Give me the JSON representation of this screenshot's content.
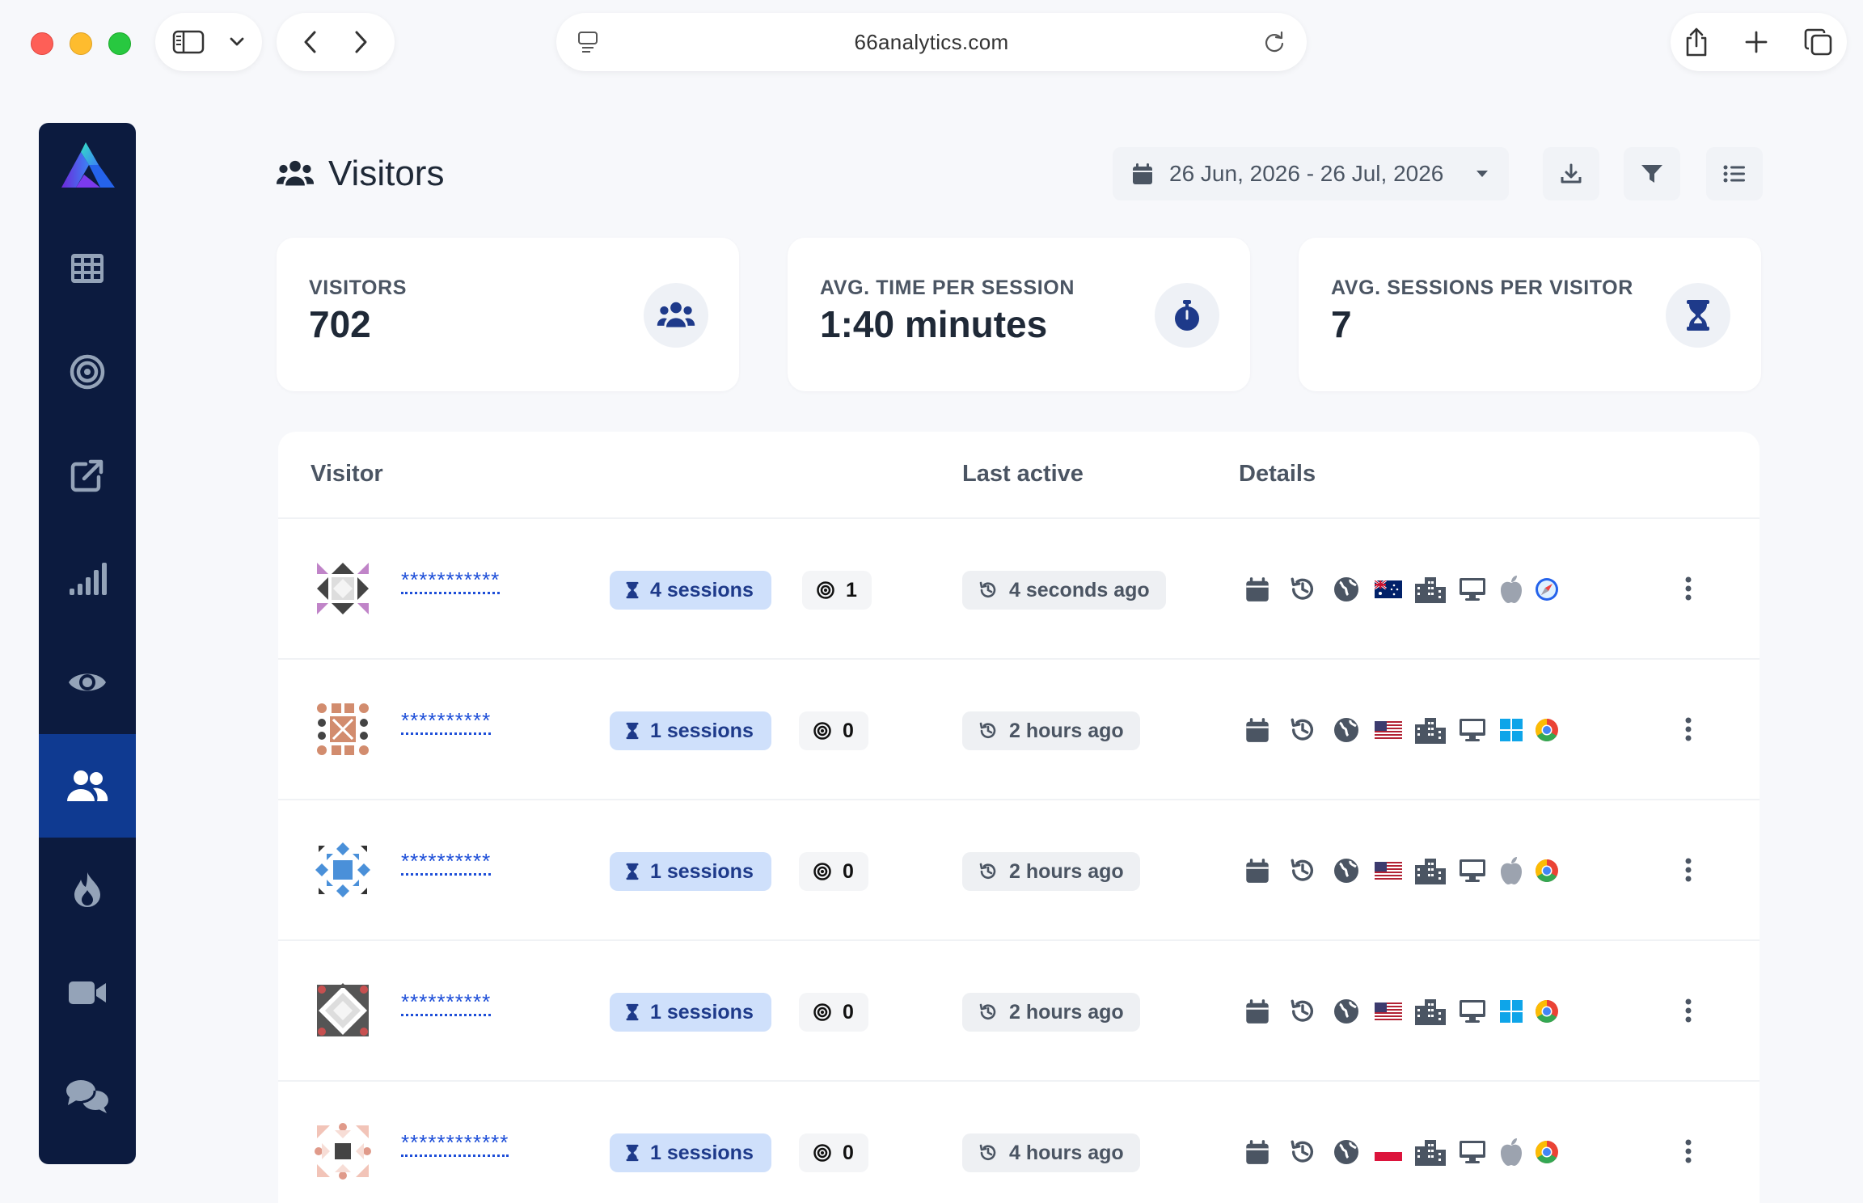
{
  "browser": {
    "url": "66analytics.com"
  },
  "sidebar": {
    "items": [
      {
        "icon": "grid-icon"
      },
      {
        "icon": "target-icon"
      },
      {
        "icon": "external-link-icon"
      },
      {
        "icon": "signal-bars-icon"
      },
      {
        "icon": "eye-icon"
      },
      {
        "icon": "users-icon",
        "active": true
      },
      {
        "icon": "fire-icon"
      },
      {
        "icon": "video-icon"
      },
      {
        "icon": "comments-icon"
      }
    ]
  },
  "header": {
    "title": "Visitors",
    "date_range": "26 Jun, 2026 - 26 Jul, 2026"
  },
  "stats": [
    {
      "label": "VISITORS",
      "value": "702",
      "icon": "users-icon"
    },
    {
      "label": "AVG. TIME PER SESSION",
      "value": "1:40 minutes",
      "icon": "stopwatch-icon"
    },
    {
      "label": "AVG. SESSIONS PER VISITOR",
      "value": "7",
      "icon": "hourglass-icon"
    }
  ],
  "table": {
    "columns": [
      "Visitor",
      "Last active",
      "Details"
    ],
    "rows": [
      {
        "visitor_id": "***********",
        "sessions": "4 sessions",
        "goals": "1",
        "last_active": "4 seconds ago",
        "flag": "AU",
        "os": "apple",
        "browser": "safari"
      },
      {
        "visitor_id": "**********",
        "sessions": "1 sessions",
        "goals": "0",
        "last_active": "2 hours ago",
        "flag": "US",
        "os": "windows",
        "browser": "chrome"
      },
      {
        "visitor_id": "**********",
        "sessions": "1 sessions",
        "goals": "0",
        "last_active": "2 hours ago",
        "flag": "US",
        "os": "apple",
        "browser": "chrome"
      },
      {
        "visitor_id": "**********",
        "sessions": "1 sessions",
        "goals": "0",
        "last_active": "2 hours ago",
        "flag": "US",
        "os": "windows",
        "browser": "chrome"
      },
      {
        "visitor_id": "************",
        "sessions": "1 sessions",
        "goals": "0",
        "last_active": "4 hours ago",
        "flag": "PL",
        "os": "apple",
        "browser": "chrome"
      }
    ]
  }
}
